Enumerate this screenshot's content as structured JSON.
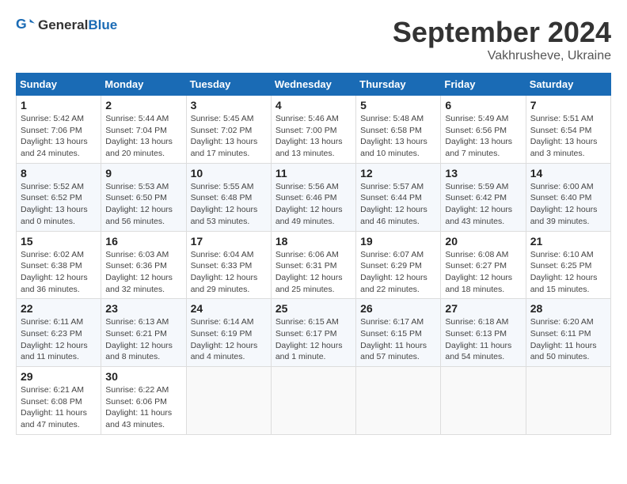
{
  "header": {
    "logo_general": "General",
    "logo_blue": "Blue",
    "month_title": "September 2024",
    "subtitle": "Vakhrusheve, Ukraine"
  },
  "days_of_week": [
    "Sunday",
    "Monday",
    "Tuesday",
    "Wednesday",
    "Thursday",
    "Friday",
    "Saturday"
  ],
  "weeks": [
    [
      {
        "day": "1",
        "sunrise": "Sunrise: 5:42 AM",
        "sunset": "Sunset: 7:06 PM",
        "daylight": "Daylight: 13 hours and 24 minutes."
      },
      {
        "day": "2",
        "sunrise": "Sunrise: 5:44 AM",
        "sunset": "Sunset: 7:04 PM",
        "daylight": "Daylight: 13 hours and 20 minutes."
      },
      {
        "day": "3",
        "sunrise": "Sunrise: 5:45 AM",
        "sunset": "Sunset: 7:02 PM",
        "daylight": "Daylight: 13 hours and 17 minutes."
      },
      {
        "day": "4",
        "sunrise": "Sunrise: 5:46 AM",
        "sunset": "Sunset: 7:00 PM",
        "daylight": "Daylight: 13 hours and 13 minutes."
      },
      {
        "day": "5",
        "sunrise": "Sunrise: 5:48 AM",
        "sunset": "Sunset: 6:58 PM",
        "daylight": "Daylight: 13 hours and 10 minutes."
      },
      {
        "day": "6",
        "sunrise": "Sunrise: 5:49 AM",
        "sunset": "Sunset: 6:56 PM",
        "daylight": "Daylight: 13 hours and 7 minutes."
      },
      {
        "day": "7",
        "sunrise": "Sunrise: 5:51 AM",
        "sunset": "Sunset: 6:54 PM",
        "daylight": "Daylight: 13 hours and 3 minutes."
      }
    ],
    [
      {
        "day": "8",
        "sunrise": "Sunrise: 5:52 AM",
        "sunset": "Sunset: 6:52 PM",
        "daylight": "Daylight: 13 hours and 0 minutes."
      },
      {
        "day": "9",
        "sunrise": "Sunrise: 5:53 AM",
        "sunset": "Sunset: 6:50 PM",
        "daylight": "Daylight: 12 hours and 56 minutes."
      },
      {
        "day": "10",
        "sunrise": "Sunrise: 5:55 AM",
        "sunset": "Sunset: 6:48 PM",
        "daylight": "Daylight: 12 hours and 53 minutes."
      },
      {
        "day": "11",
        "sunrise": "Sunrise: 5:56 AM",
        "sunset": "Sunset: 6:46 PM",
        "daylight": "Daylight: 12 hours and 49 minutes."
      },
      {
        "day": "12",
        "sunrise": "Sunrise: 5:57 AM",
        "sunset": "Sunset: 6:44 PM",
        "daylight": "Daylight: 12 hours and 46 minutes."
      },
      {
        "day": "13",
        "sunrise": "Sunrise: 5:59 AM",
        "sunset": "Sunset: 6:42 PM",
        "daylight": "Daylight: 12 hours and 43 minutes."
      },
      {
        "day": "14",
        "sunrise": "Sunrise: 6:00 AM",
        "sunset": "Sunset: 6:40 PM",
        "daylight": "Daylight: 12 hours and 39 minutes."
      }
    ],
    [
      {
        "day": "15",
        "sunrise": "Sunrise: 6:02 AM",
        "sunset": "Sunset: 6:38 PM",
        "daylight": "Daylight: 12 hours and 36 minutes."
      },
      {
        "day": "16",
        "sunrise": "Sunrise: 6:03 AM",
        "sunset": "Sunset: 6:36 PM",
        "daylight": "Daylight: 12 hours and 32 minutes."
      },
      {
        "day": "17",
        "sunrise": "Sunrise: 6:04 AM",
        "sunset": "Sunset: 6:33 PM",
        "daylight": "Daylight: 12 hours and 29 minutes."
      },
      {
        "day": "18",
        "sunrise": "Sunrise: 6:06 AM",
        "sunset": "Sunset: 6:31 PM",
        "daylight": "Daylight: 12 hours and 25 minutes."
      },
      {
        "day": "19",
        "sunrise": "Sunrise: 6:07 AM",
        "sunset": "Sunset: 6:29 PM",
        "daylight": "Daylight: 12 hours and 22 minutes."
      },
      {
        "day": "20",
        "sunrise": "Sunrise: 6:08 AM",
        "sunset": "Sunset: 6:27 PM",
        "daylight": "Daylight: 12 hours and 18 minutes."
      },
      {
        "day": "21",
        "sunrise": "Sunrise: 6:10 AM",
        "sunset": "Sunset: 6:25 PM",
        "daylight": "Daylight: 12 hours and 15 minutes."
      }
    ],
    [
      {
        "day": "22",
        "sunrise": "Sunrise: 6:11 AM",
        "sunset": "Sunset: 6:23 PM",
        "daylight": "Daylight: 12 hours and 11 minutes."
      },
      {
        "day": "23",
        "sunrise": "Sunrise: 6:13 AM",
        "sunset": "Sunset: 6:21 PM",
        "daylight": "Daylight: 12 hours and 8 minutes."
      },
      {
        "day": "24",
        "sunrise": "Sunrise: 6:14 AM",
        "sunset": "Sunset: 6:19 PM",
        "daylight": "Daylight: 12 hours and 4 minutes."
      },
      {
        "day": "25",
        "sunrise": "Sunrise: 6:15 AM",
        "sunset": "Sunset: 6:17 PM",
        "daylight": "Daylight: 12 hours and 1 minute."
      },
      {
        "day": "26",
        "sunrise": "Sunrise: 6:17 AM",
        "sunset": "Sunset: 6:15 PM",
        "daylight": "Daylight: 11 hours and 57 minutes."
      },
      {
        "day": "27",
        "sunrise": "Sunrise: 6:18 AM",
        "sunset": "Sunset: 6:13 PM",
        "daylight": "Daylight: 11 hours and 54 minutes."
      },
      {
        "day": "28",
        "sunrise": "Sunrise: 6:20 AM",
        "sunset": "Sunset: 6:11 PM",
        "daylight": "Daylight: 11 hours and 50 minutes."
      }
    ],
    [
      {
        "day": "29",
        "sunrise": "Sunrise: 6:21 AM",
        "sunset": "Sunset: 6:08 PM",
        "daylight": "Daylight: 11 hours and 47 minutes."
      },
      {
        "day": "30",
        "sunrise": "Sunrise: 6:22 AM",
        "sunset": "Sunset: 6:06 PM",
        "daylight": "Daylight: 11 hours and 43 minutes."
      },
      null,
      null,
      null,
      null,
      null
    ]
  ]
}
